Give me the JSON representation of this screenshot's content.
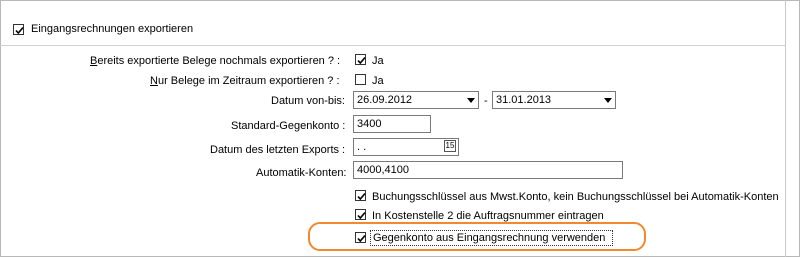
{
  "header": {
    "checkbox_checked": true,
    "title": "Eingangsrechnungen exportieren"
  },
  "form": {
    "bereits_label": "Bereits exportierte Belege nochmals exportieren ?",
    "bereits_suffix": ":",
    "bereits_checked": true,
    "bereits_value_label": "Ja",
    "nur_label": "Nur Belege im Zeitraum exportieren ?",
    "nur_suffix": ":",
    "nur_checked": false,
    "nur_value_label": "Ja",
    "datum_label": "Datum von-bis:",
    "datum_von": "26.09.2012",
    "datum_separator": "-",
    "datum_bis": "31.01.2013",
    "standard_label": "Standard-Gegenkonto :",
    "standard_value": "3400",
    "letzter_export_label": "Datum des letzten Exports :",
    "letzter_export_value": " .  .",
    "automatik_label": "Automatik-Konten:",
    "automatik_value": "4000,4100"
  },
  "options": [
    {
      "label": "Buchungsschlüssel  aus Mwst.Konto, kein Buchungsschlüssel bei Automatik-Konten",
      "checked": true
    },
    {
      "label": "In Kostenstelle 2 die Auftragsnummer eintragen",
      "checked": true
    },
    {
      "label": "Gegenkonto aus Eingangsrechnung verwenden",
      "checked": true
    }
  ],
  "colors": {
    "highlight": "#f08a2c"
  }
}
